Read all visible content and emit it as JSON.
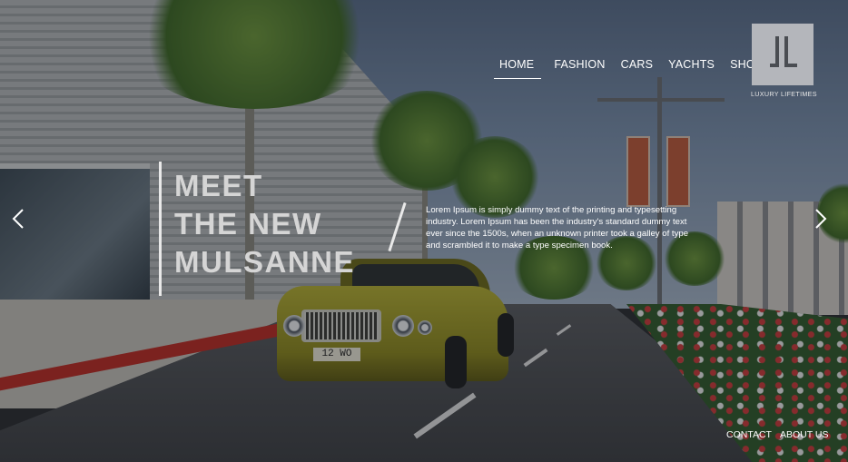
{
  "nav": {
    "items": [
      {
        "label": "HOME",
        "active": true
      },
      {
        "label": "FASHION",
        "active": false
      },
      {
        "label": "CARS",
        "active": false
      },
      {
        "label": "YACHTS",
        "active": false
      },
      {
        "label": "SHOP",
        "active": false
      }
    ]
  },
  "brand": {
    "caption": "LUXURY LIFETIMES",
    "logo_bg": "#b4b6bb",
    "logo_fg": "#4a4d52"
  },
  "hero": {
    "title_lines": [
      "MEET",
      "THE NEW",
      "MULSANNE"
    ],
    "body": "Lorem Ipsum is simply dummy text of the printing and typesetting industry. Lorem Ipsum has been the industry's standard dummy text ever since the 1500s, when an unknown printer took a galley of type and scrambled it to make a type specimen book."
  },
  "car": {
    "plate": "12 WO",
    "color": "#a8a22a"
  },
  "carousel": {
    "prev_icon": "chevron-left-icon",
    "next_icon": "chevron-right-icon"
  },
  "footer": {
    "links": [
      {
        "label": "CONTACT"
      },
      {
        "label": "ABOUT US"
      }
    ]
  }
}
